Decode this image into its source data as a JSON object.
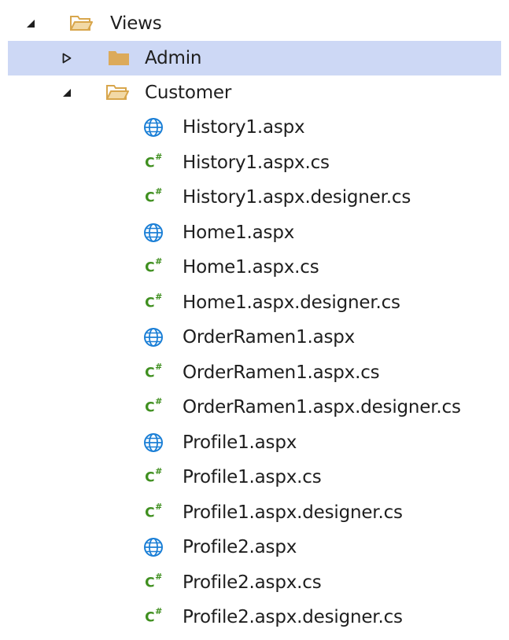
{
  "colors": {
    "selected_bg": "#cdd8f5",
    "folder_open": "#d8a64c",
    "folder_closed": "#dcaa5a",
    "web_icon": "#1b7fd6",
    "cs_icon": "#3f8f1f"
  },
  "tree": {
    "views": {
      "label": "Views",
      "expander": "expanded-arrow",
      "icon": "folder-open-icon"
    },
    "admin": {
      "label": "Admin",
      "expander": "collapsed-arrow",
      "icon": "folder-closed-icon"
    },
    "customer": {
      "label": "Customer",
      "expander": "expanded-arrow",
      "icon": "folder-open-icon"
    },
    "cs_glyph": "C",
    "files": [
      {
        "label": "History1.aspx",
        "icon": "web-page-icon"
      },
      {
        "label": "History1.aspx.cs",
        "icon": "csharp-file-icon"
      },
      {
        "label": "History1.aspx.designer.cs",
        "icon": "csharp-file-icon"
      },
      {
        "label": "Home1.aspx",
        "icon": "web-page-icon"
      },
      {
        "label": "Home1.aspx.cs",
        "icon": "csharp-file-icon"
      },
      {
        "label": "Home1.aspx.designer.cs",
        "icon": "csharp-file-icon"
      },
      {
        "label": "OrderRamen1.aspx",
        "icon": "web-page-icon"
      },
      {
        "label": "OrderRamen1.aspx.cs",
        "icon": "csharp-file-icon"
      },
      {
        "label": "OrderRamen1.aspx.designer.cs",
        "icon": "csharp-file-icon"
      },
      {
        "label": "Profile1.aspx",
        "icon": "web-page-icon"
      },
      {
        "label": "Profile1.aspx.cs",
        "icon": "csharp-file-icon"
      },
      {
        "label": "Profile1.aspx.designer.cs",
        "icon": "csharp-file-icon"
      },
      {
        "label": "Profile2.aspx",
        "icon": "web-page-icon"
      },
      {
        "label": "Profile2.aspx.cs",
        "icon": "csharp-file-icon"
      },
      {
        "label": "Profile2.aspx.designer.cs",
        "icon": "csharp-file-icon"
      }
    ]
  }
}
